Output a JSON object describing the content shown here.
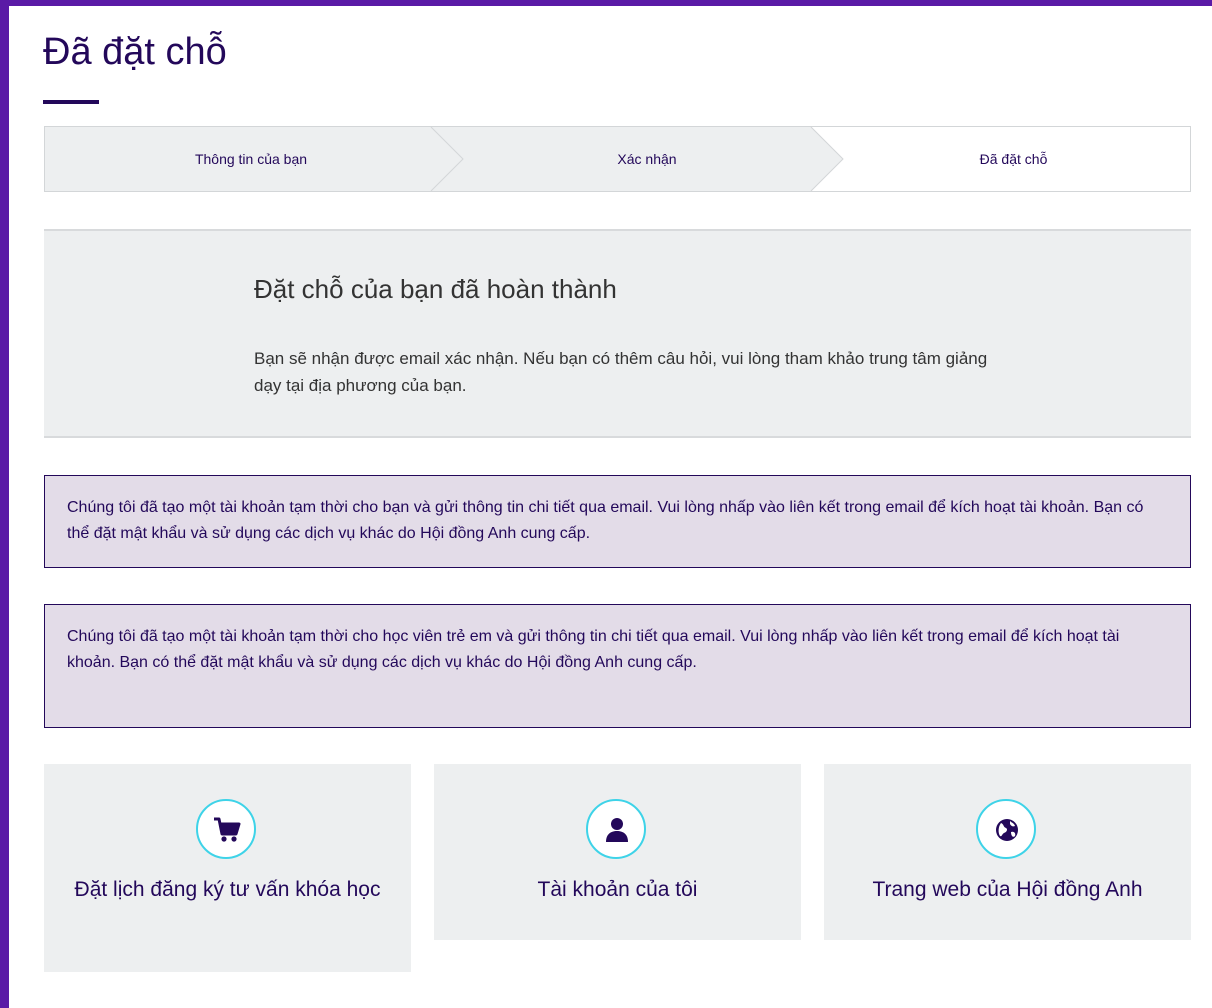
{
  "page": {
    "title": "Đã đặt chỗ"
  },
  "steps": [
    {
      "label": "Thông tin của bạn",
      "state": "completed"
    },
    {
      "label": "Xác nhận",
      "state": "completed"
    },
    {
      "label": "Đã đặt chỗ",
      "state": "current"
    }
  ],
  "success": {
    "title": "Đặt chỗ của bạn đã hoàn thành",
    "text": "Bạn sẽ nhận được email xác nhận. Nếu bạn có thêm câu hỏi, vui lòng tham khảo trung tâm giảng dạy tại địa phương của bạn."
  },
  "notices": [
    "Chúng tôi đã tạo một tài khoản tạm thời cho bạn và gửi thông tin chi tiết qua email. Vui lòng nhấp vào liên kết trong email để kích hoạt tài khoản. Bạn có thể đặt mật khẩu và sử dụng các dịch vụ khác do Hội đồng Anh cung cấp.",
    "Chúng tôi đã tạo một tài khoản tạm thời cho học viên trẻ em và gửi thông tin chi tiết qua email. Vui lòng nhấp vào liên kết trong email để kích hoạt tài khoản. Bạn có thể đặt mật khẩu và sử dụng các dịch vụ khác do Hội đồng Anh cung cấp."
  ],
  "cards": [
    {
      "label": "Đặt lịch đăng ký tư vấn khóa học",
      "icon": "cart-icon"
    },
    {
      "label": "Tài khoản của tôi",
      "icon": "user-icon"
    },
    {
      "label": "Trang web của Hội đồng Anh",
      "icon": "globe-icon"
    }
  ],
  "colors": {
    "brand": "#23085a",
    "frame": "#5a1aa6",
    "icon_ring": "#3ed3e8",
    "panel": "#edeff0",
    "notice": "#e3dce8"
  }
}
